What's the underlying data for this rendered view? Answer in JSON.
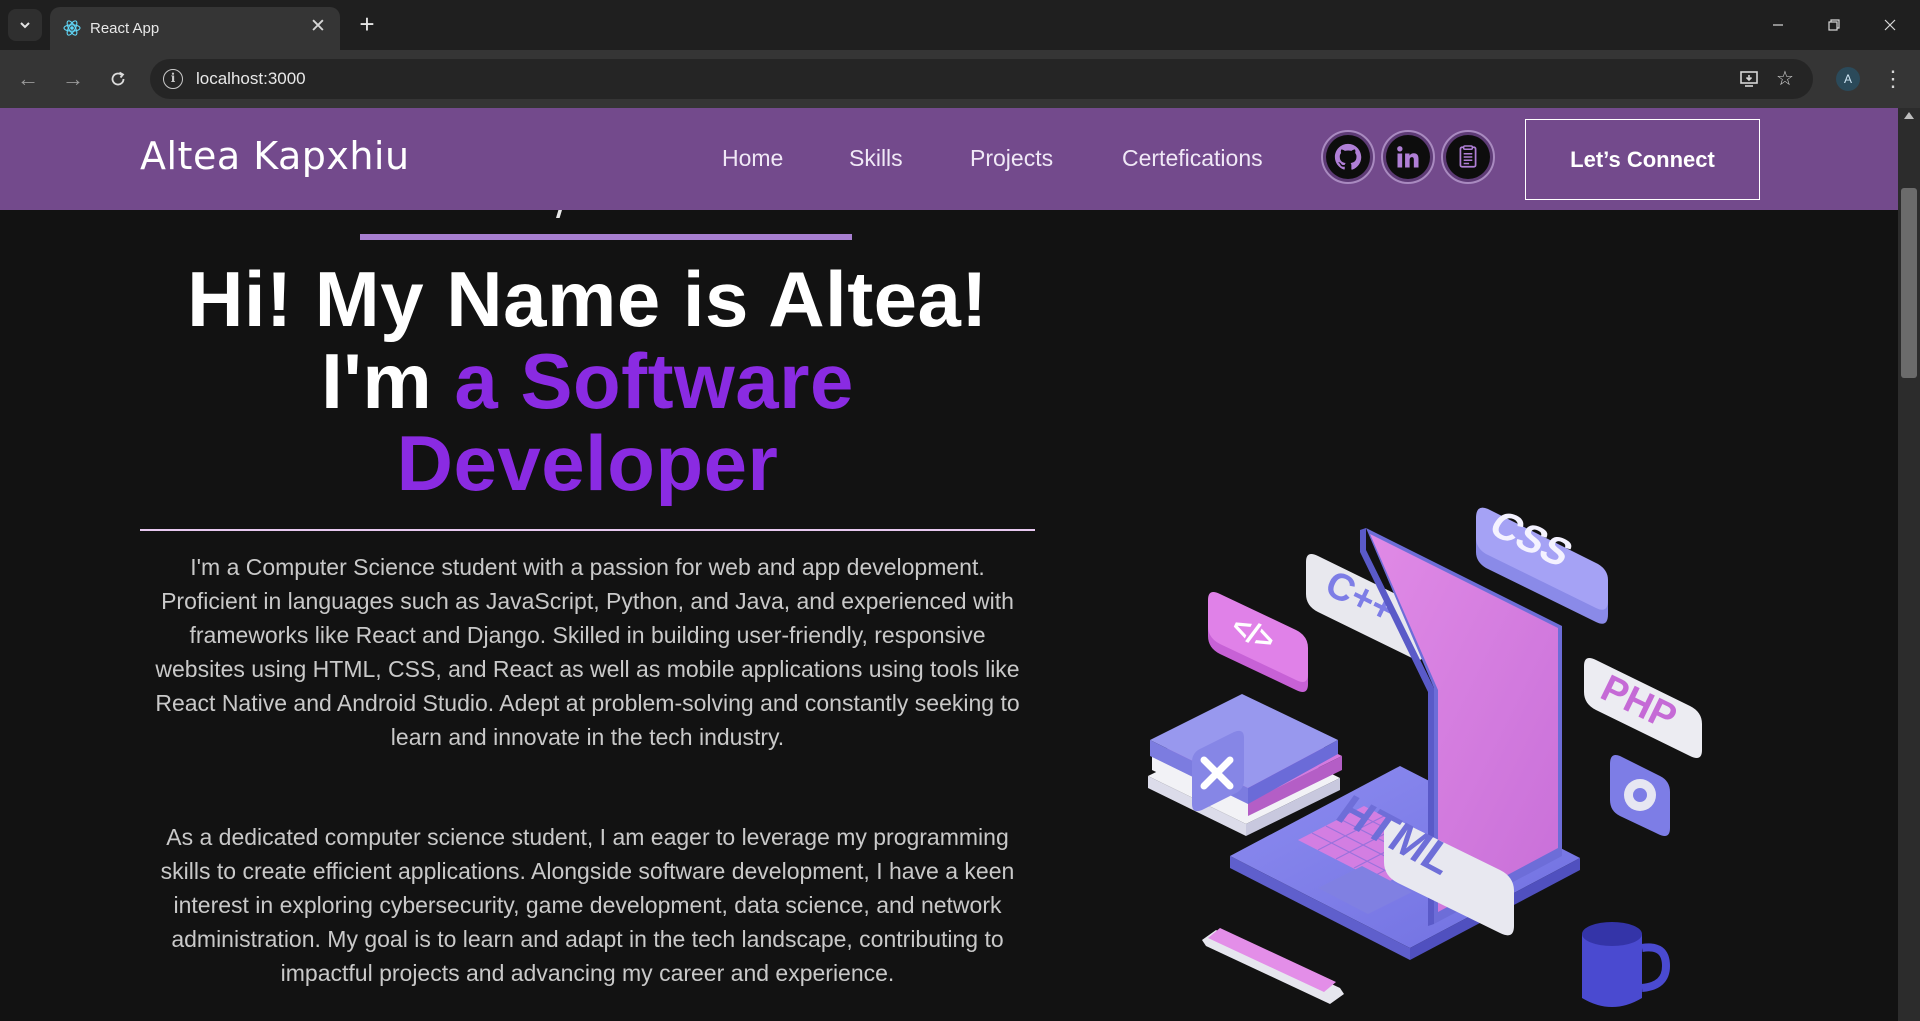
{
  "browser": {
    "tab_title": "React App",
    "url": "localhost:3000",
    "profile_initial": "A"
  },
  "navbar": {
    "brand": "Altea Kapxhiu",
    "links": [
      "Home",
      "Skills",
      "Projects",
      "Certefications"
    ],
    "cta": "Let’s Connect",
    "socials": [
      "github-icon",
      "linkedin-icon",
      "resume-icon"
    ]
  },
  "hero": {
    "title_line1": "Hi! My Name is Altea!",
    "title_prefix": "I'm ",
    "title_accent": "a Software Developer",
    "bio_paragraph1": "I'm a Computer Science student with a passion for web and app development. Proficient in languages such as JavaScript, Python, and Java, and experienced with frameworks like React and Django. Skilled in building user-friendly, responsive websites using HTML, CSS, and React as well as mobile applications using tools like React Native and Android Studio. Adept at problem-solving and constantly seeking to learn and innovate in the tech industry.",
    "bio_paragraph2": "As a dedicated computer science student, I am eager to leverage my programming skills to create efficient applications. Alongside software development, I have a keen interest in exploring cybersecurity, game development, data science, and network administration. My goal is to learn and adapt in the tech landscape, contributing to impactful projects and advancing my career and experience."
  },
  "illustration": {
    "labels": [
      "CSS",
      "C++",
      "</>",
      "PHP",
      "HTML"
    ]
  },
  "colors": {
    "navbar_bg": "#734a8c",
    "accent": "#8a2be2",
    "page_bg": "#121212"
  }
}
